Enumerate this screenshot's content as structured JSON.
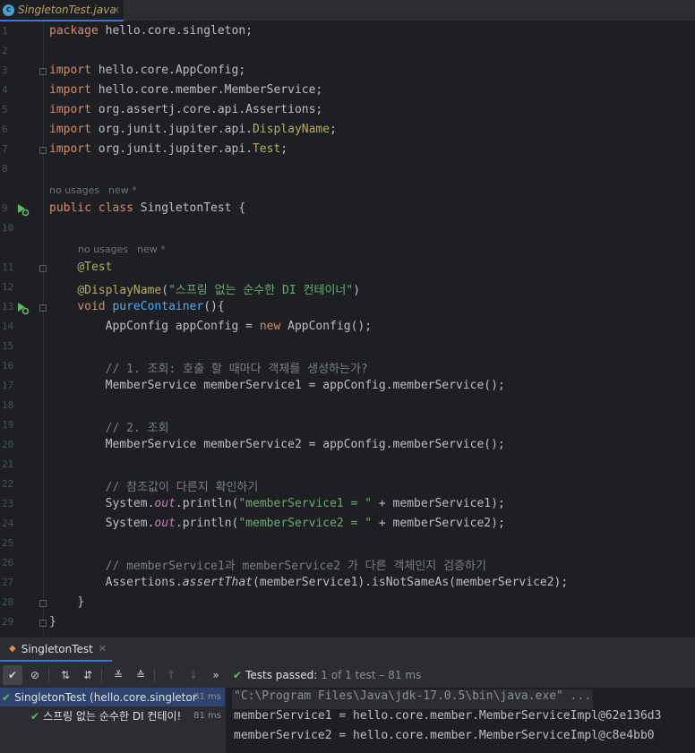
{
  "editor_tab": {
    "icon": "c",
    "label": "SingletonTest.java"
  },
  "editor": {
    "hints": {
      "usages": "no usages",
      "author": "new *"
    },
    "line_numbers": [
      "1",
      "2",
      "3",
      "4",
      "5",
      "6",
      "7",
      "8",
      "9",
      "10",
      "11",
      "12",
      "13",
      "14",
      "15",
      "16",
      "17",
      "18",
      "19",
      "20",
      "21",
      "22",
      "23",
      "24",
      "25",
      "26",
      "27",
      "28",
      "29"
    ],
    "code": {
      "l1": {
        "kw": "package",
        "rest": " hello.core.singleton;"
      },
      "l3": {
        "kw": "import",
        "rest": " hello.core.AppConfig;"
      },
      "l4": {
        "kw": "import",
        "rest": " hello.core.member.MemberService;"
      },
      "l5": {
        "kw": "import",
        "rest": " org.assertj.core.api.Assertions;"
      },
      "l6": {
        "kw": "import",
        "pre": " org.junit.jupiter.api.",
        "ann": "DisplayName",
        "post": ";"
      },
      "l7": {
        "kw": "import",
        "pre": " org.junit.jupiter.api.",
        "ann": "Test",
        "post": ";"
      },
      "l9": {
        "kw": "public class",
        "rest": " SingletonTest {"
      },
      "l11": {
        "ann": "@Test"
      },
      "l12": {
        "ann": "@DisplayName",
        "open": "(",
        "str": "\"스프링 없는 순수한 DI 컨테이너\"",
        "close": ")"
      },
      "l13": {
        "kw": "void",
        "fn": "pureContainer",
        "rest": "(){"
      },
      "l14": {
        "pre": "AppConfig appConfig = ",
        "kw": "new",
        "post": " AppConfig();"
      },
      "l16": {
        "comment": "// 1. 조회: 호출 할 때마다 객체를 생성하는가?"
      },
      "l17": {
        "text": "MemberService memberService1 = appConfig.memberService();"
      },
      "l19": {
        "comment": "// 2. 조회"
      },
      "l20": {
        "text": "MemberService memberService2 = appConfig.memberService();"
      },
      "l22": {
        "comment": "// 참조값이 다른지 확인하기"
      },
      "l23": {
        "pre": "System.",
        "field": "out",
        "mid": ".println(",
        "str": "\"memberService1 = \"",
        "post": " + memberService1);"
      },
      "l24": {
        "pre": "System.",
        "field": "out",
        "mid": ".println(",
        "str": "\"memberService2 = \"",
        "post": " + memberService2);"
      },
      "l26": {
        "comment": "// memberService1과 memberService2 가 다른 객체인지 검증하기"
      },
      "l27": {
        "pre": "Assertions.",
        "method": "assertThat",
        "post": "(memberService1).isNotSameAs(memberService2);"
      },
      "l28": {
        "text": "}"
      },
      "l29": {
        "text": "}"
      }
    }
  },
  "run_window": {
    "tab_label": "SingletonTest",
    "status": {
      "label": "Tests passed:",
      "counts": "1 of 1 test – 81 ms"
    },
    "tree": [
      {
        "name": "SingletonTest (hello.core.singletor",
        "time": "81 ms"
      },
      {
        "name": "스프링 없는 순수한 DI 컨테이!",
        "time": "81 ms"
      }
    ],
    "console": [
      "\"C:\\Program Files\\Java\\jdk-17.0.5\\bin\\java.exe\" ...",
      "memberService1 = hello.core.member.MemberServiceImpl@62e136d3",
      "memberService2 = hello.core.member.MemberServiceImpl@c8e4bb0"
    ]
  },
  "colors": {
    "editor_bg": "#1e1f22",
    "panel_bg": "#2b2d30",
    "keyword": "#cf8e6d",
    "annotation": "#b3ae60",
    "string": "#6aab73",
    "comment": "#7a7e85",
    "method": "#56a8f5",
    "static_field": "#c77dbb",
    "passed": "#5fb865",
    "selection": "#2e436e"
  }
}
